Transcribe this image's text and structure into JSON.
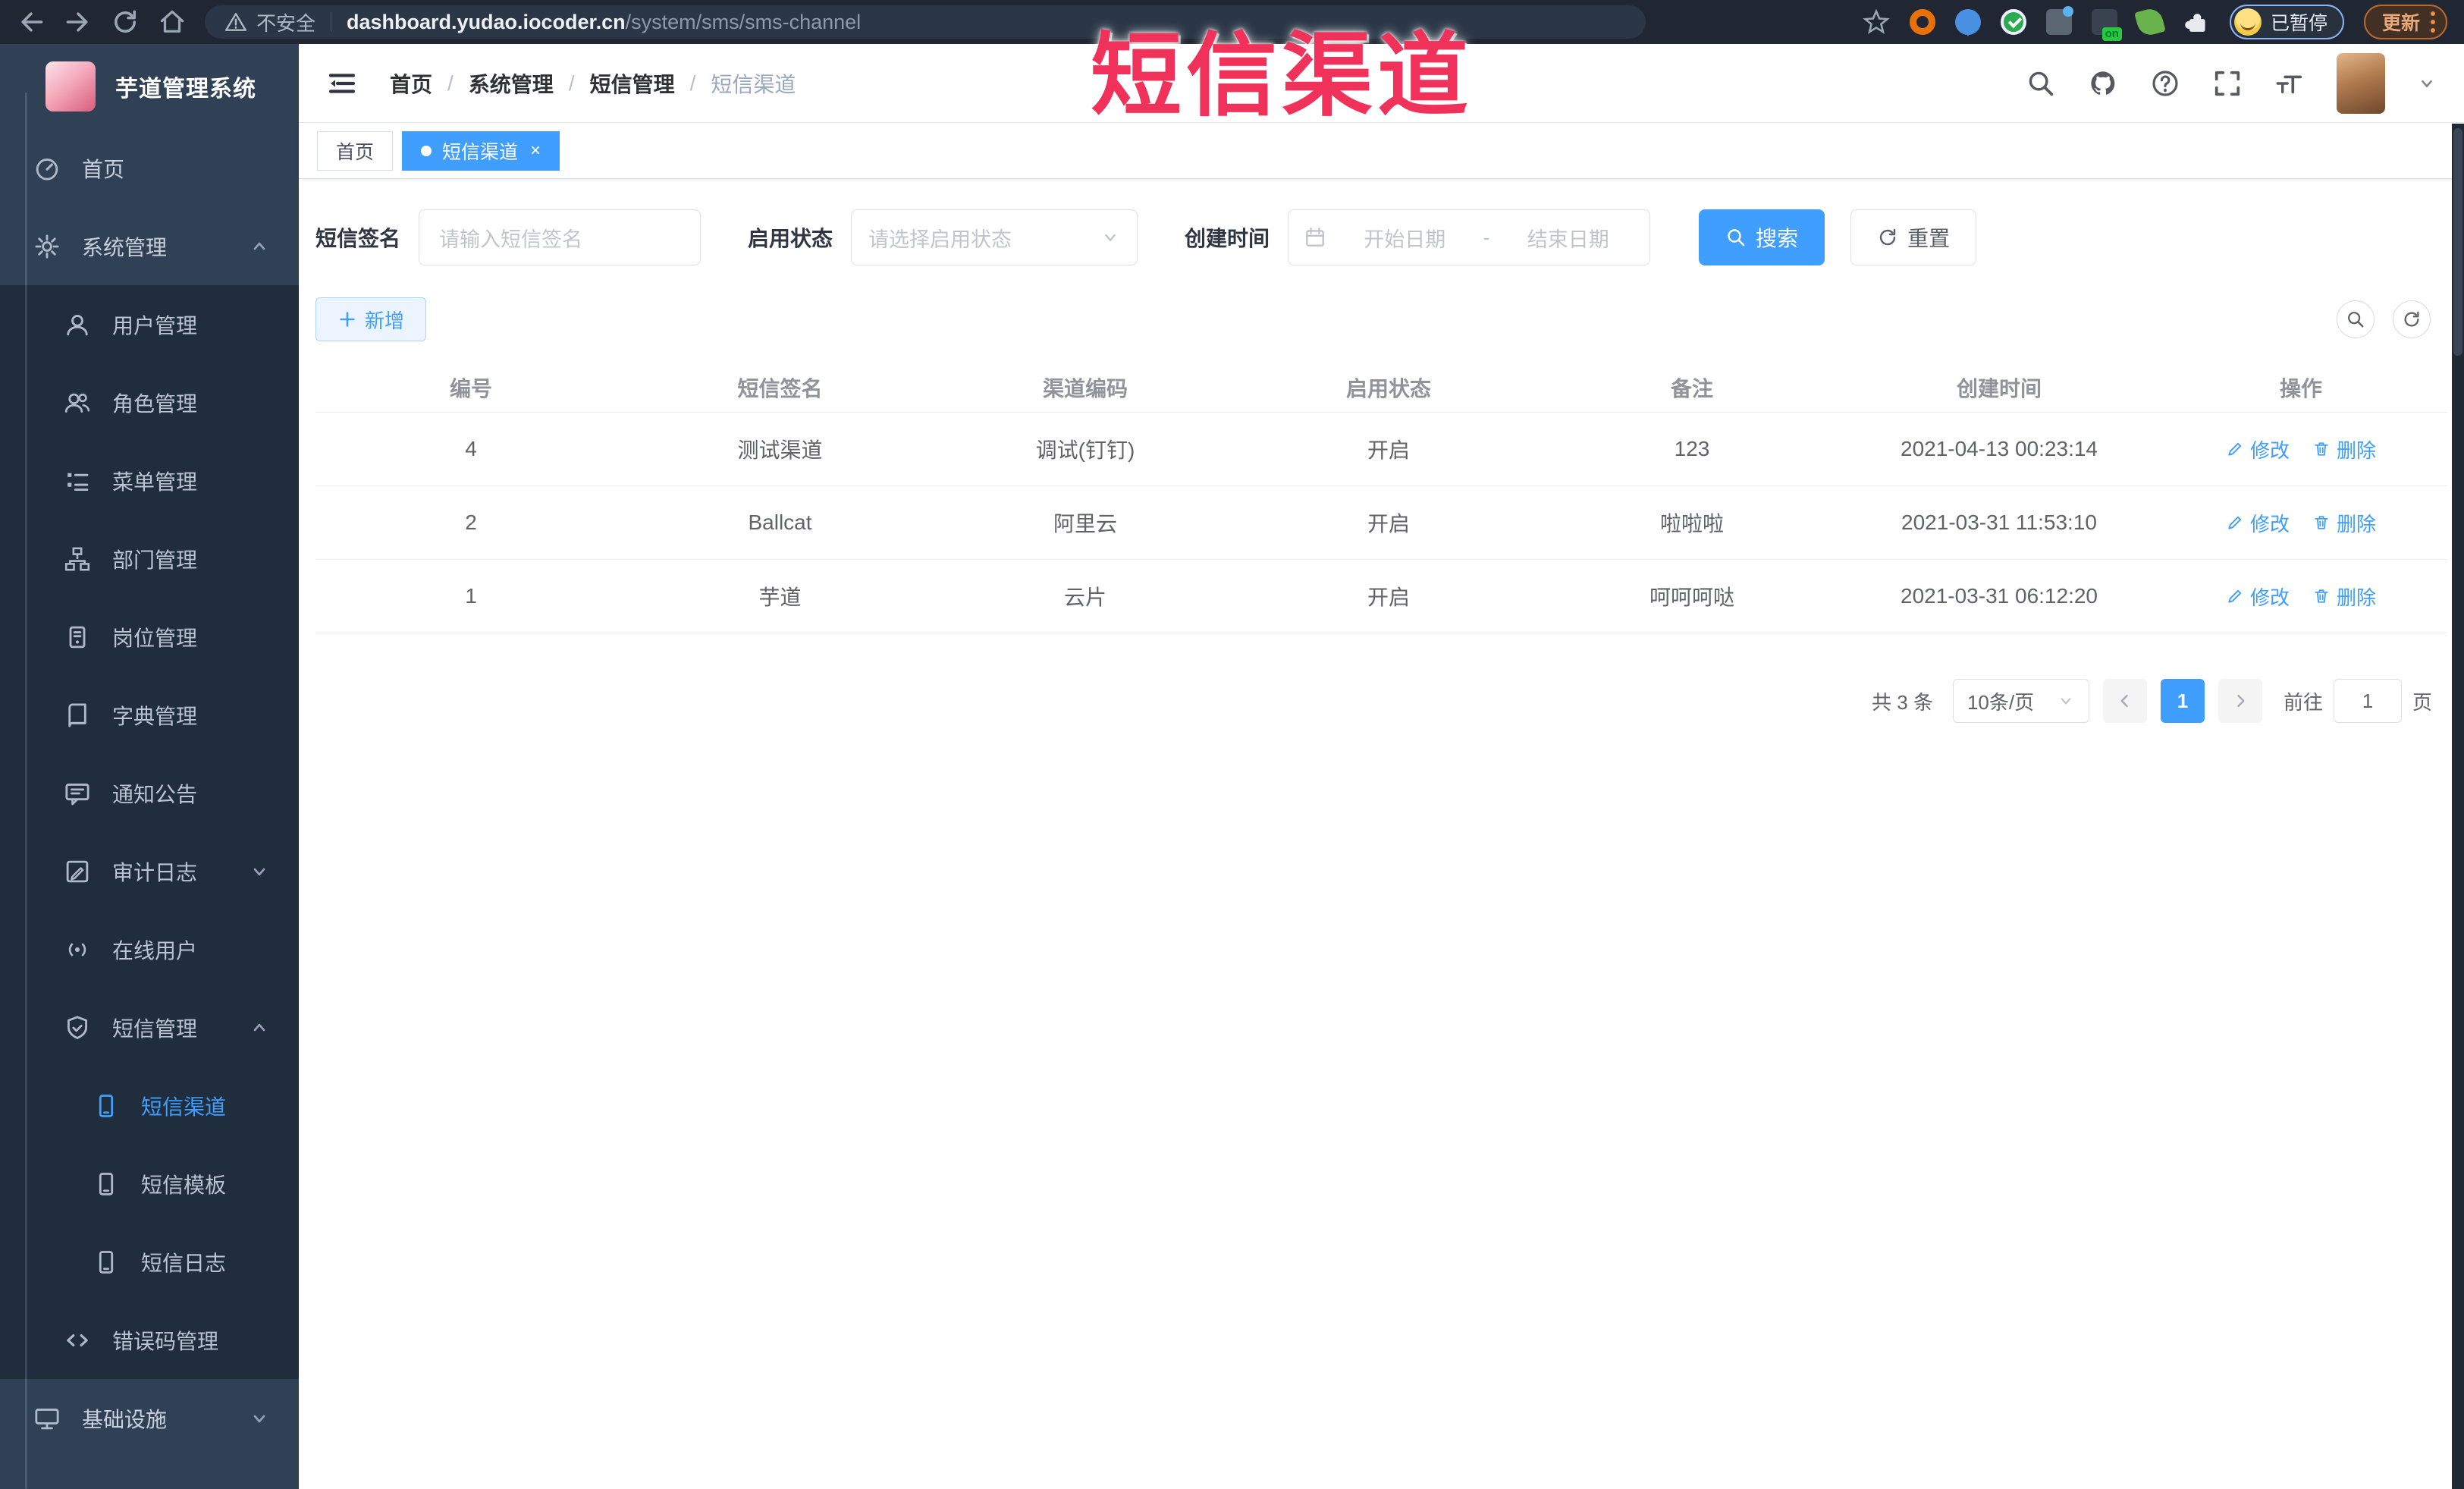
{
  "colors": {
    "accent": "#409eff",
    "overlay_red": "#f0325a",
    "sidebar_bg": "#304156",
    "submenu_bg": "#1f2d3d",
    "browser_bg": "#202733"
  },
  "browser": {
    "security_label": "不安全",
    "url_domain": "dashboard.yudao.iocoder.cn",
    "url_path": "/system/sms/sms-channel",
    "profile_badge": "已暂停",
    "update_label": "更新"
  },
  "overlay": {
    "title": "短信渠道"
  },
  "sidebar": {
    "logo_title": "芋道管理系统",
    "items": [
      {
        "label": "首页",
        "icon": "dashboard-icon",
        "level": 1
      },
      {
        "label": "系统管理",
        "icon": "gear-icon",
        "level": 1,
        "caret": "up"
      },
      {
        "label": "用户管理",
        "icon": "user-icon",
        "level": 2
      },
      {
        "label": "角色管理",
        "icon": "roles-icon",
        "level": 2
      },
      {
        "label": "菜单管理",
        "icon": "menu-tree-icon",
        "level": 2
      },
      {
        "label": "部门管理",
        "icon": "org-icon",
        "level": 2
      },
      {
        "label": "岗位管理",
        "icon": "post-icon",
        "level": 2
      },
      {
        "label": "字典管理",
        "icon": "dict-icon",
        "level": 2
      },
      {
        "label": "通知公告",
        "icon": "notice-icon",
        "level": 2
      },
      {
        "label": "审计日志",
        "icon": "log-icon",
        "level": 2,
        "caret": "down"
      },
      {
        "label": "在线用户",
        "icon": "online-icon",
        "level": 2
      },
      {
        "label": "短信管理",
        "icon": "shield-icon",
        "level": 2,
        "caret": "up"
      },
      {
        "label": "短信渠道",
        "icon": "phone-icon",
        "level": 3,
        "active": true
      },
      {
        "label": "短信模板",
        "icon": "phone-icon",
        "level": 3
      },
      {
        "label": "短信日志",
        "icon": "phone-icon",
        "level": 3
      },
      {
        "label": "错误码管理",
        "icon": "code-icon",
        "level": 2
      },
      {
        "label": "基础设施",
        "icon": "monitor-icon",
        "level": 1,
        "caret": "down"
      }
    ]
  },
  "breadcrumb": {
    "items": [
      "首页",
      "系统管理",
      "短信管理",
      "短信渠道"
    ]
  },
  "tabs": {
    "items": [
      {
        "label": "首页",
        "active": false,
        "closable": false
      },
      {
        "label": "短信渠道",
        "active": true,
        "closable": true
      }
    ]
  },
  "filters": {
    "sign_label": "短信签名",
    "sign_placeholder": "请输入短信签名",
    "status_label": "启用状态",
    "status_placeholder": "请选择启用状态",
    "time_label": "创建时间",
    "date_start_placeholder": "开始日期",
    "date_separator": "-",
    "date_end_placeholder": "结束日期",
    "search_label": "搜索",
    "reset_label": "重置"
  },
  "toolbar": {
    "add_label": "新增"
  },
  "table": {
    "headers": [
      "编号",
      "短信签名",
      "渠道编码",
      "启用状态",
      "备注",
      "创建时间",
      "操作"
    ],
    "rows": [
      {
        "id": "4",
        "sign": "测试渠道",
        "code": "调试(钉钉)",
        "status": "开启",
        "remark": "123",
        "created": "2021-04-13 00:23:14"
      },
      {
        "id": "2",
        "sign": "Ballcat",
        "code": "阿里云",
        "status": "开启",
        "remark": "啦啦啦",
        "created": "2021-03-31 11:53:10"
      },
      {
        "id": "1",
        "sign": "芋道",
        "code": "云片",
        "status": "开启",
        "remark": "呵呵呵哒",
        "created": "2021-03-31 06:12:20"
      }
    ],
    "edit_label": "修改",
    "delete_label": "删除"
  },
  "pagination": {
    "total_text": "共 3 条",
    "page_size": "10条/页",
    "current_page": "1",
    "goto_label": "前往",
    "goto_value": "1",
    "page_unit": "页"
  }
}
